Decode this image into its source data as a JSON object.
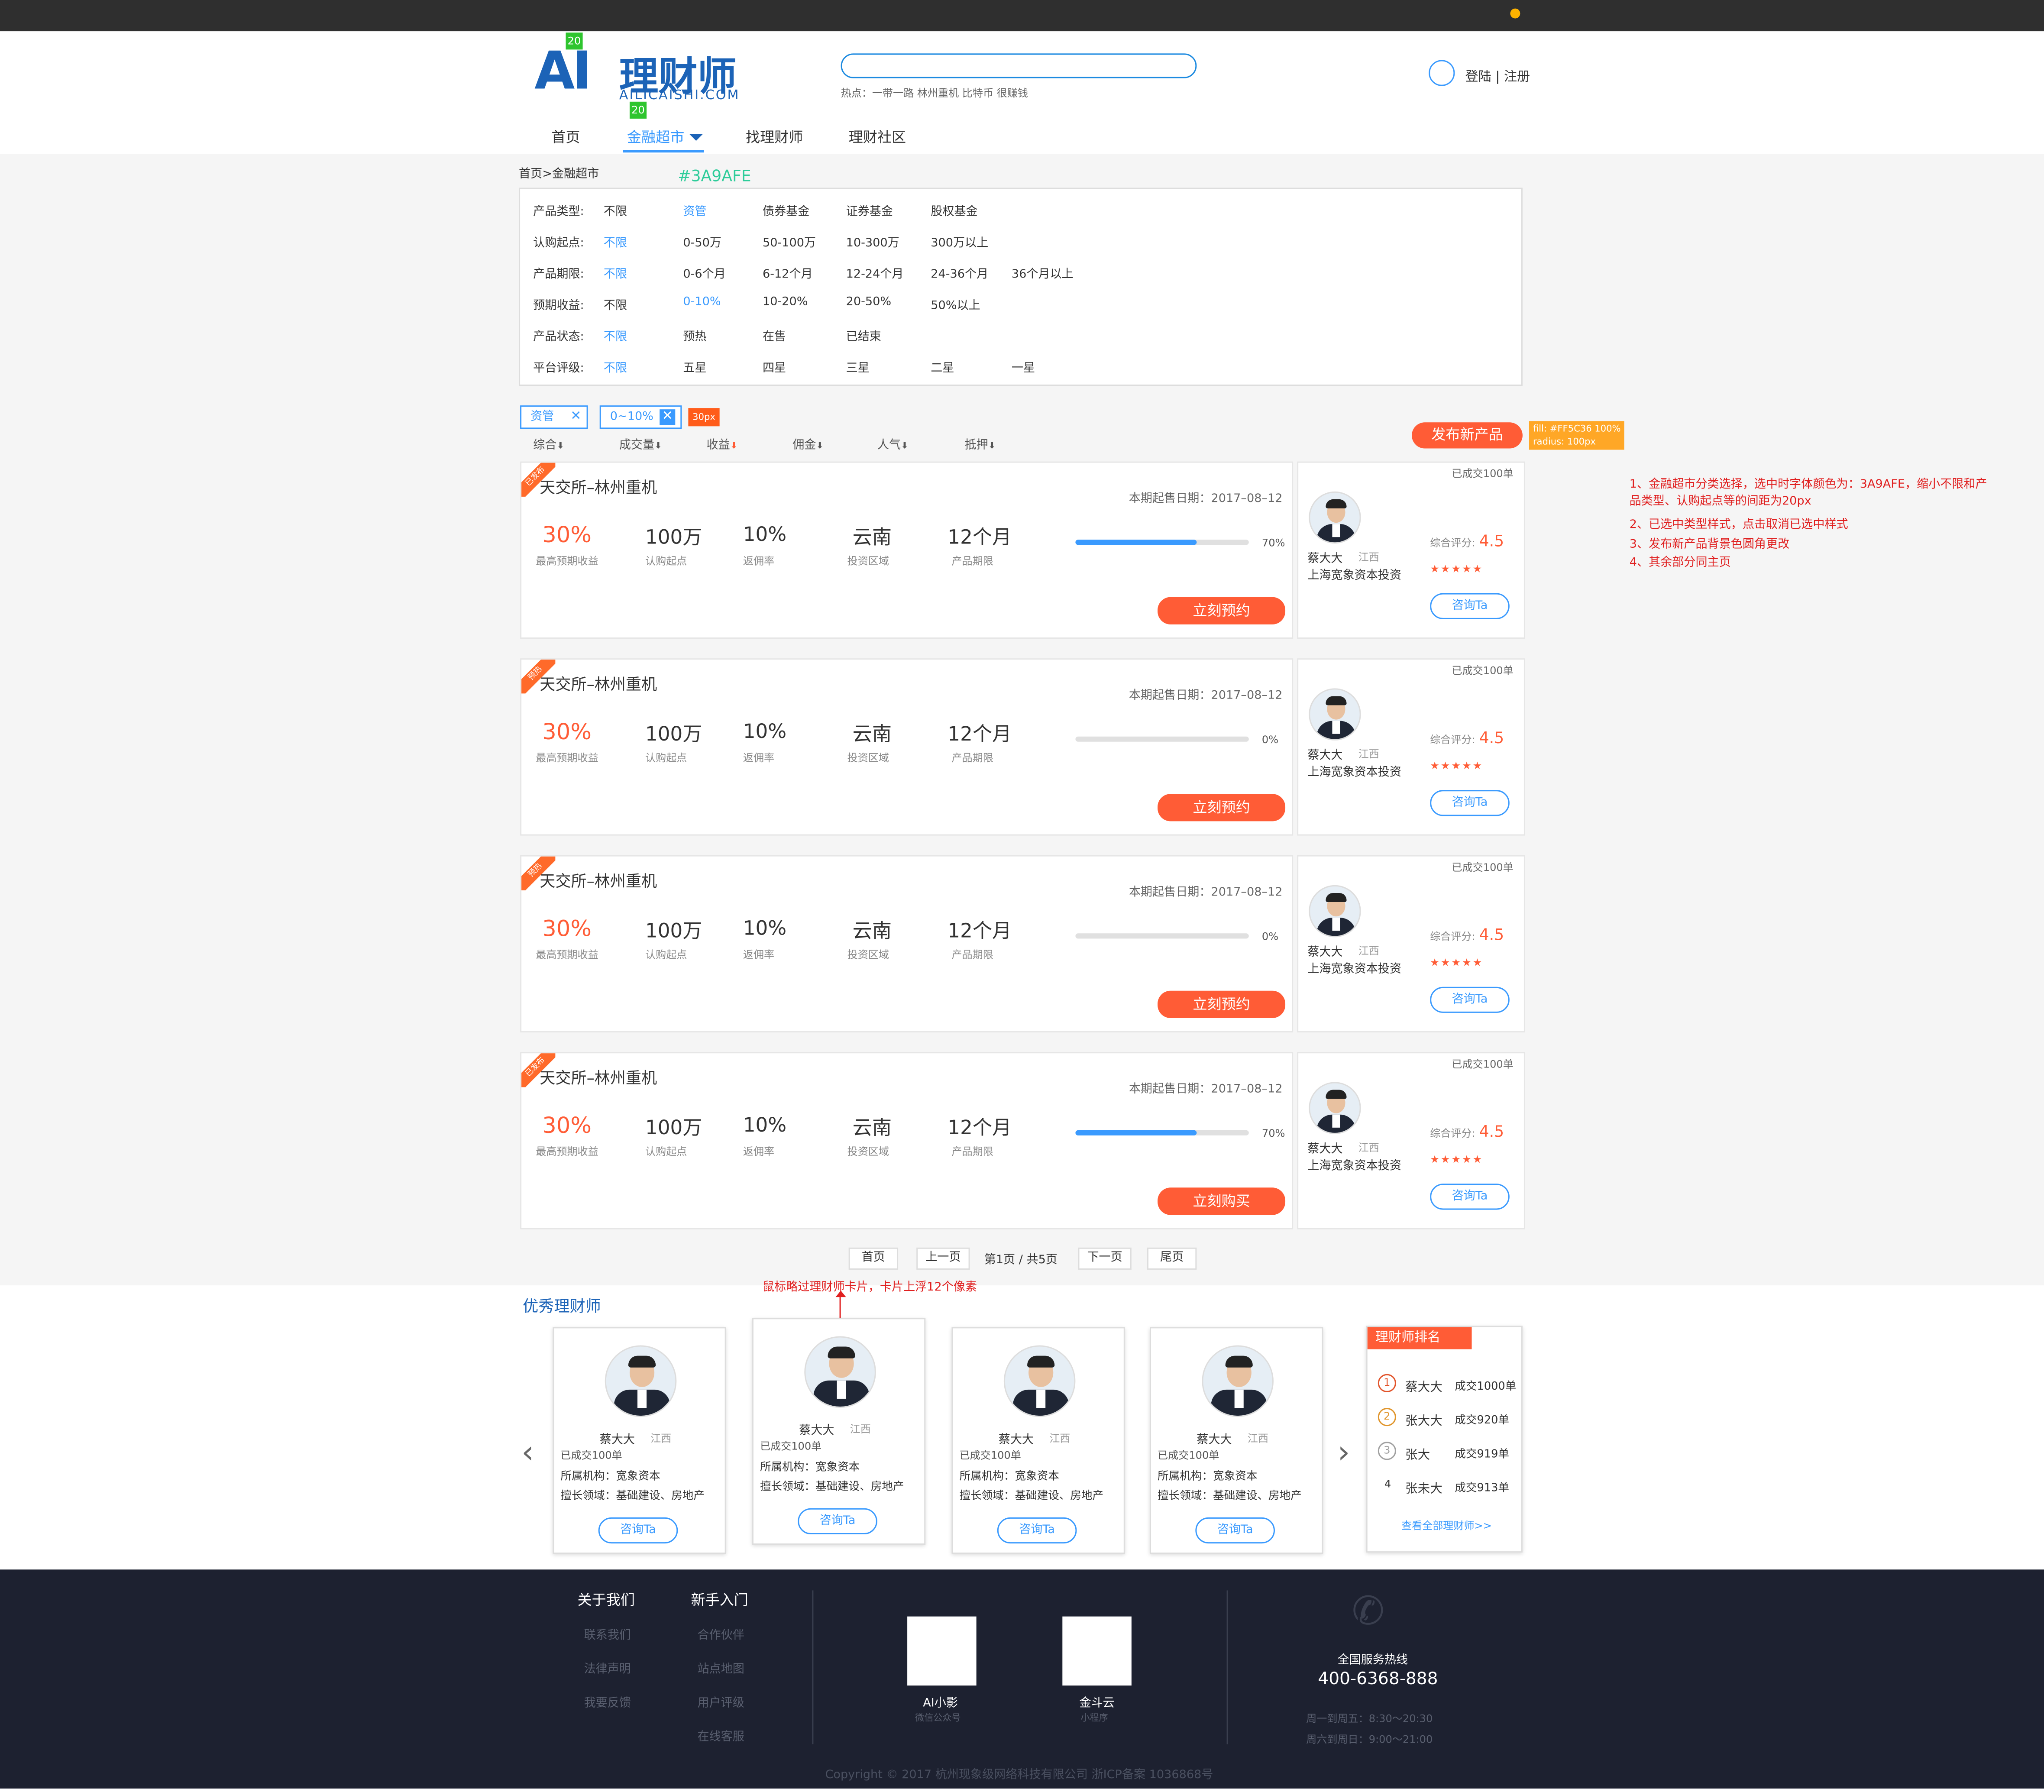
{
  "brand": {
    "ai": "AI",
    "cn": "理财师",
    "en": "AILICAISHI.COM",
    "badge": "20"
  },
  "search": {
    "placeholder": "",
    "hot": "热点：一带一路 林州重机 比特币 很赚钱"
  },
  "user": {
    "login": "登陆 | 注册"
  },
  "nav": [
    "首页",
    "金融超市",
    "找理财师",
    "理财社区"
  ],
  "breadcrumb": "首页>金融超市",
  "color_note": "#3A9AFE",
  "colors": {
    "accent": "#3A9AFE",
    "orange": "#FF5C36",
    "brand": "#1C63B7",
    "footer": "#1D2130"
  },
  "filters": [
    {
      "label": "产品类型:",
      "opts": [
        "不限",
        "资管",
        "债券基金",
        "证券基金",
        "股权基金"
      ],
      "selected": 1
    },
    {
      "label": "认购起点:",
      "opts": [
        "不限",
        "0-50万",
        "50-100万",
        "10-300万",
        "300万以上"
      ],
      "selected": 0
    },
    {
      "label": "产品期限:",
      "opts": [
        "不限",
        "0-6个月",
        "6-12个月",
        "12-24个月",
        "24-36个月",
        "36个月以上"
      ],
      "selected": 0
    },
    {
      "label": "预期收益:",
      "opts": [
        "不限",
        "0-10%",
        "10-20%",
        "20-50%",
        "50%以上"
      ],
      "selected": 1
    },
    {
      "label": "产品状态:",
      "opts": [
        "不限",
        "预热",
        "在售",
        "已结束"
      ],
      "selected": 0
    },
    {
      "label": "平台评级:",
      "opts": [
        "不限",
        "五星",
        "四星",
        "三星",
        "二星",
        "一星"
      ],
      "selected": 0
    }
  ],
  "selected_tags": [
    "资管",
    "0~10%"
  ],
  "spacing_note": "30px",
  "sort": [
    "综合",
    "成交量",
    "收益",
    "佣金",
    "人气",
    "抵押"
  ],
  "publish": {
    "label": "发布新产品",
    "note": "fill: #FF5C36 100%\nradius: 100px"
  },
  "notes": [
    "1、金融超市分类选择，选中时字体颜色为：3A9AFE，缩小不限和产",
    "品类型、认购起点等的间距为20px",
    "2、已选中类型样式，点击取消已选中样式",
    "3、发布新产品背景色圆角更改",
    "4、其余部分同主页"
  ],
  "products": [
    {
      "tag": "已发布",
      "title": "天交所–林州重机",
      "date": "本期起售日期：2017–08–12",
      "rate": "30%",
      "rate_l": "最高预期收益",
      "min": "100万",
      "min_l": "认购起点",
      "rebate": "10%",
      "rebate_l": "返佣率",
      "area": "云南",
      "area_l": "投资区域",
      "term": "12个月",
      "term_l": "产品期限",
      "progress": 0.7,
      "pct": "70%",
      "action": "立刻预约",
      "deal": "已成交100单",
      "name": "蔡大大",
      "prov": "江西",
      "org": "上海宽象资本投资",
      "score_l": "综合评分:",
      "score": "4.5",
      "stars": "★★★★★",
      "ask": "咨询Ta"
    },
    {
      "tag": "预热",
      "title": "天交所–林州重机",
      "date": "本期起售日期：2017–08–12",
      "rate": "30%",
      "rate_l": "最高预期收益",
      "min": "100万",
      "min_l": "认购起点",
      "rebate": "10%",
      "rebate_l": "返佣率",
      "area": "云南",
      "area_l": "投资区域",
      "term": "12个月",
      "term_l": "产品期限",
      "progress": 0,
      "pct": "0%",
      "action": "立刻预约",
      "deal": "已成交100单",
      "name": "蔡大大",
      "prov": "江西",
      "org": "上海宽象资本投资",
      "score_l": "综合评分:",
      "score": "4.5",
      "stars": "★★★★★",
      "ask": "咨询Ta"
    },
    {
      "tag": "预热",
      "title": "天交所–林州重机",
      "date": "本期起售日期：2017–08–12",
      "rate": "30%",
      "rate_l": "最高预期收益",
      "min": "100万",
      "min_l": "认购起点",
      "rebate": "10%",
      "rebate_l": "返佣率",
      "area": "云南",
      "area_l": "投资区域",
      "term": "12个月",
      "term_l": "产品期限",
      "progress": 0,
      "pct": "0%",
      "action": "立刻预约",
      "deal": "已成交100单",
      "name": "蔡大大",
      "prov": "江西",
      "org": "上海宽象资本投资",
      "score_l": "综合评分:",
      "score": "4.5",
      "stars": "★★★★★",
      "ask": "咨询Ta"
    },
    {
      "tag": "已发布",
      "title": "天交所–林州重机",
      "date": "本期起售日期：2017–08–12",
      "rate": "30%",
      "rate_l": "最高预期收益",
      "min": "100万",
      "min_l": "认购起点",
      "rebate": "10%",
      "rebate_l": "返佣率",
      "area": "云南",
      "area_l": "投资区域",
      "term": "12个月",
      "term_l": "产品期限",
      "progress": 0.7,
      "pct": "70%",
      "action": "立刻购买",
      "deal": "已成交100单",
      "name": "蔡大大",
      "prov": "江西",
      "org": "上海宽象资本投资",
      "score_l": "综合评分:",
      "score": "4.5",
      "stars": "★★★★★",
      "ask": "咨询Ta"
    }
  ],
  "pager": {
    "first": "首页",
    "prev": "上一页",
    "info": "第1页 / 共5页",
    "next": "下一页",
    "last": "尾页"
  },
  "hover_note": "鼠标略过理财师卡片，卡片上浮12个像素",
  "advisors_title": "优秀理财师",
  "advisors": [
    {
      "name": "蔡大大",
      "prov": "江西",
      "deal": "已成交100单",
      "org": "所属机构：宽象资本",
      "field": "擅长领域：基础建设、房地产",
      "ask": "咨询Ta"
    },
    {
      "name": "蔡大大",
      "prov": "江西",
      "deal": "已成交100单",
      "org": "所属机构：宽象资本",
      "field": "擅长领域：基础建设、房地产",
      "ask": "咨询Ta"
    },
    {
      "name": "蔡大大",
      "prov": "江西",
      "deal": "已成交100单",
      "org": "所属机构：宽象资本",
      "field": "擅长领域：基础建设、房地产",
      "ask": "咨询Ta"
    },
    {
      "name": "蔡大大",
      "prov": "江西",
      "deal": "已成交100单",
      "org": "所属机构：宽象资本",
      "field": "擅长领域：基础建设、房地产",
      "ask": "咨询Ta"
    }
  ],
  "ranking": {
    "title": "理财师排名",
    "rows": [
      {
        "rank": "1",
        "name": "蔡大大",
        "deal": "成交1000单"
      },
      {
        "rank": "2",
        "name": "张大大",
        "deal": "成交920单"
      },
      {
        "rank": "3",
        "name": "张大",
        "deal": "成交919单"
      },
      {
        "rank": "4",
        "name": "张未大",
        "deal": "成交913单"
      }
    ],
    "more": "查看全部理财师>>"
  },
  "footer": {
    "col1_title": "关于我们",
    "col1": [
      "联系我们",
      "法律声明",
      "我要反馈"
    ],
    "col2_title": "新手入门",
    "col2": [
      "合作伙伴",
      "站点地图",
      "用户评级",
      "在线客服"
    ],
    "qr": [
      {
        "label": "AI小影",
        "sub": "微信公众号"
      },
      {
        "label": "金斗云",
        "sub": "小程序"
      }
    ],
    "hotline_label": "全国服务热线",
    "hotline": "400-6368-888",
    "hours1": "周一到周五：8:30～20:30",
    "hours2": "周六到周日：9:00～21:00",
    "copyright": "Copyright © 2017 杭州现象级网络科技有限公司 浙ICP备案 1036868号"
  }
}
